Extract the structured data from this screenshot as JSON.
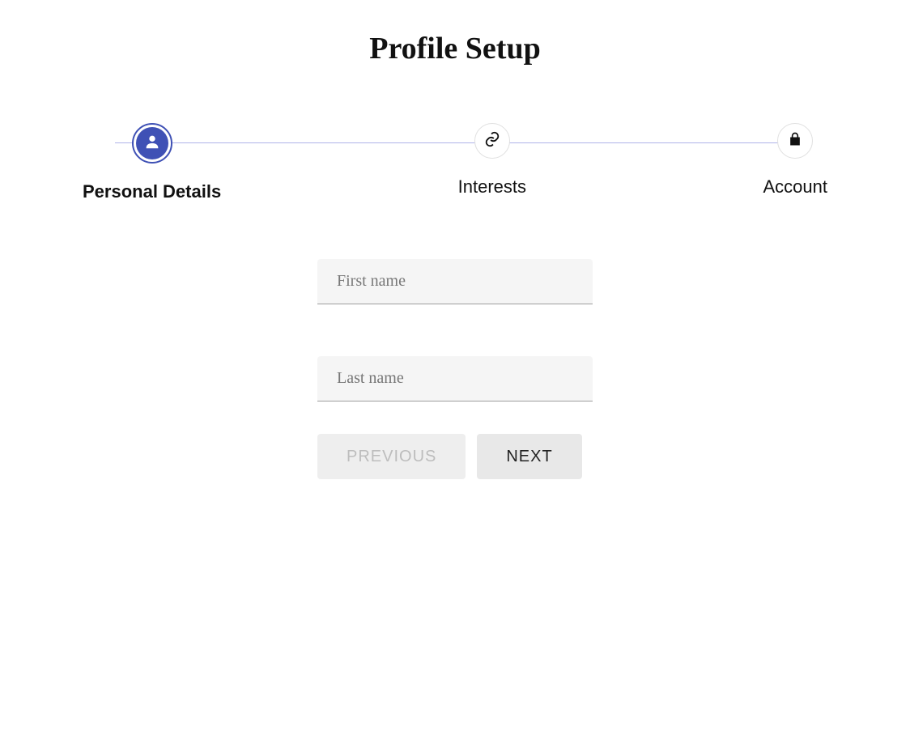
{
  "title": "Profile Setup",
  "stepper": {
    "steps": [
      {
        "label": "Personal Details",
        "icon": "person",
        "active": true
      },
      {
        "label": "Interests",
        "icon": "link",
        "active": false
      },
      {
        "label": "Account",
        "icon": "lock",
        "active": false
      }
    ]
  },
  "form": {
    "first_name": {
      "placeholder": "First name",
      "value": ""
    },
    "last_name": {
      "placeholder": "Last name",
      "value": ""
    }
  },
  "buttons": {
    "previous": "PREVIOUS",
    "next": "NEXT"
  },
  "colors": {
    "primary": "#3f51b5"
  }
}
